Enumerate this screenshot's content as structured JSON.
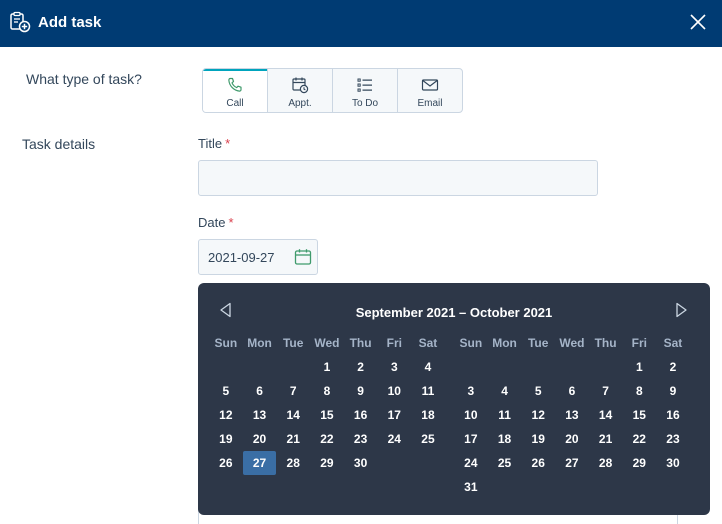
{
  "header": {
    "title": "Add task",
    "icon": "task-add-icon",
    "close_icon": "close-icon",
    "background": "#003b73"
  },
  "task_type": {
    "label": "What type of task?",
    "options": [
      {
        "label": "Call",
        "icon": "phone-icon",
        "selected": true
      },
      {
        "label": "Appt.",
        "icon": "calendar-clock-icon",
        "selected": false
      },
      {
        "label": "To Do",
        "icon": "list-icon",
        "selected": false
      },
      {
        "label": "Email",
        "icon": "email-icon",
        "selected": false
      }
    ]
  },
  "details": {
    "label": "Task details",
    "title_field": {
      "label": "Title",
      "required_mark": "*",
      "value": ""
    },
    "date_field": {
      "label": "Date",
      "required_mark": "*",
      "value": "2021-09-27"
    }
  },
  "calendar": {
    "title": "September 2021 – October 2021",
    "weekdays": [
      "Sun",
      "Mon",
      "Tue",
      "Wed",
      "Thu",
      "Fri",
      "Sat"
    ],
    "selected_date": "27",
    "months": [
      {
        "name": "September 2021",
        "weeks": [
          [
            "",
            "",
            "",
            "1",
            "2",
            "3",
            "4"
          ],
          [
            "5",
            "6",
            "7",
            "8",
            "9",
            "10",
            "11"
          ],
          [
            "12",
            "13",
            "14",
            "15",
            "16",
            "17",
            "18"
          ],
          [
            "19",
            "20",
            "21",
            "22",
            "23",
            "24",
            "25"
          ],
          [
            "26",
            "27",
            "28",
            "29",
            "30",
            "",
            ""
          ]
        ]
      },
      {
        "name": "October 2021",
        "weeks": [
          [
            "",
            "",
            "",
            "",
            "",
            "1",
            "2"
          ],
          [
            "3",
            "4",
            "5",
            "6",
            "7",
            "8",
            "9"
          ],
          [
            "10",
            "11",
            "12",
            "13",
            "14",
            "15",
            "16"
          ],
          [
            "17",
            "18",
            "19",
            "20",
            "21",
            "22",
            "23"
          ],
          [
            "24",
            "25",
            "26",
            "27",
            "28",
            "29",
            "30"
          ],
          [
            "31",
            "",
            "",
            "",
            "",
            "",
            ""
          ]
        ]
      }
    ]
  }
}
